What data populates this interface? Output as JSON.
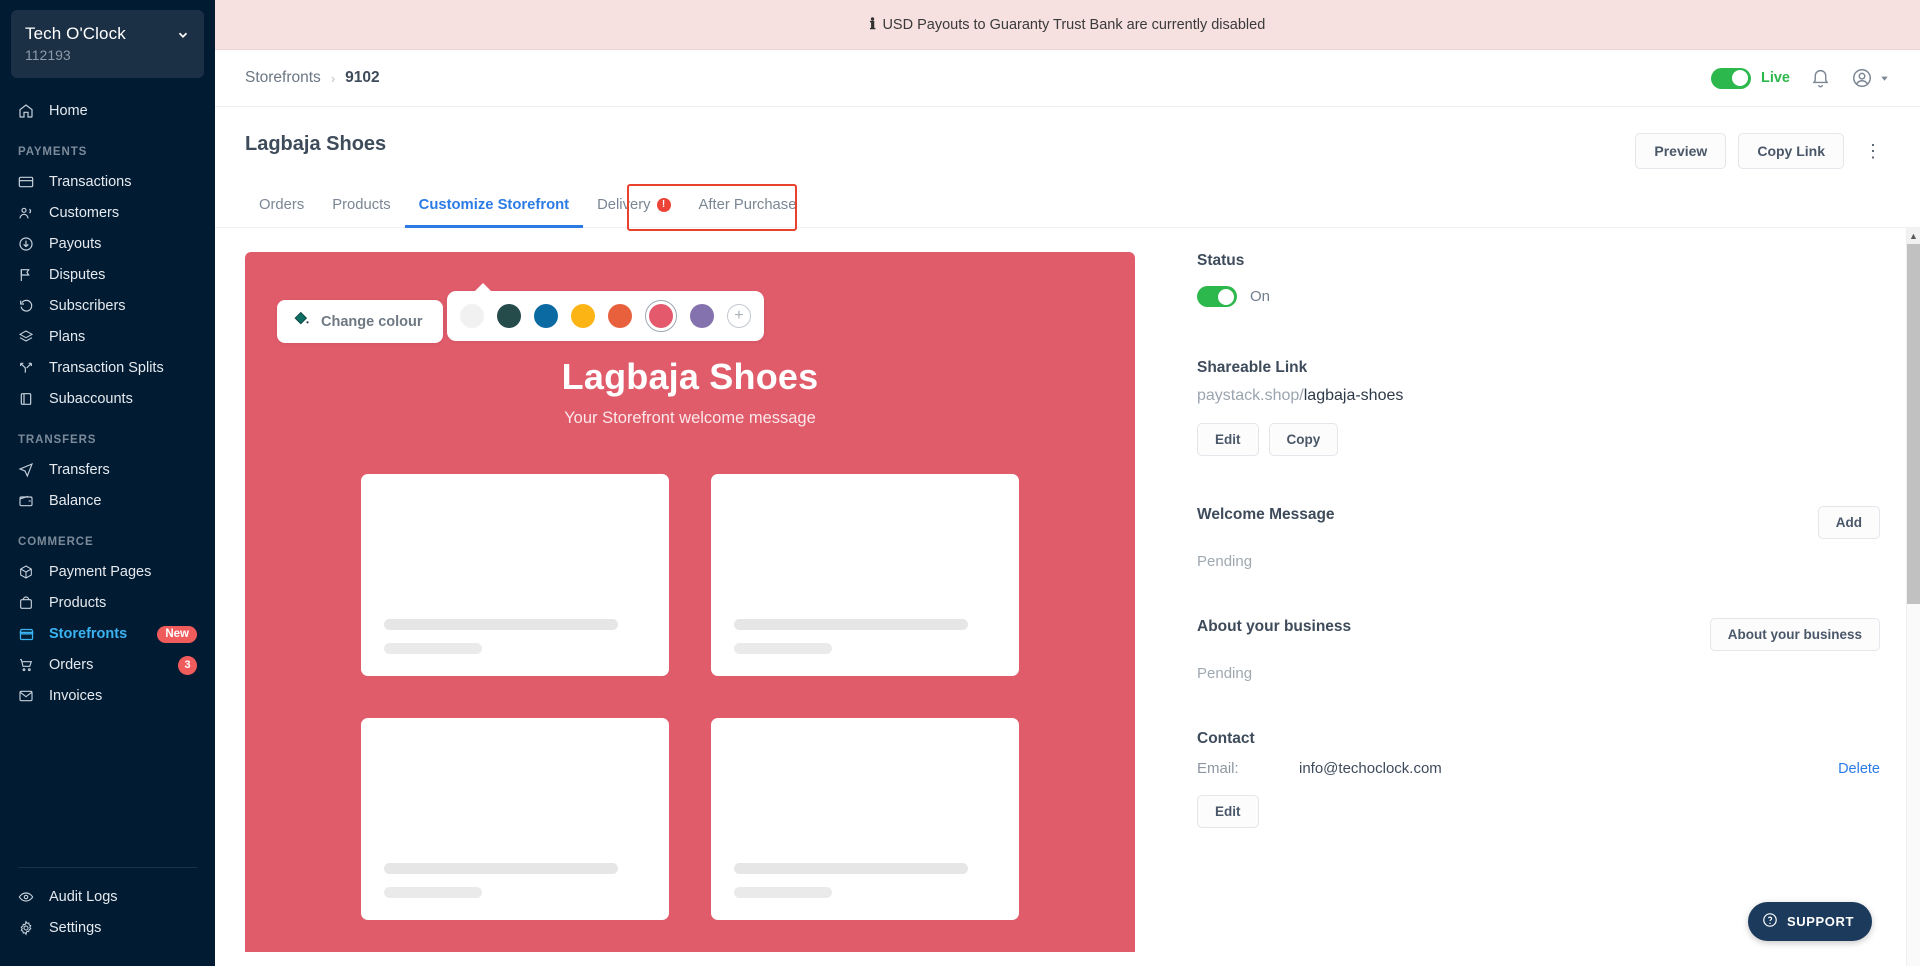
{
  "sidebar": {
    "org": {
      "name": "Tech O'Clock",
      "id": "112193",
      "chevron_icon": "chevron-down-icon"
    },
    "home": {
      "label": "Home",
      "icon": "home-icon"
    },
    "groups": [
      {
        "title": "PAYMENTS",
        "items": [
          {
            "label": "Transactions",
            "icon": "card-icon"
          },
          {
            "label": "Customers",
            "icon": "users-icon"
          },
          {
            "label": "Payouts",
            "icon": "arrow-down-circle-icon"
          },
          {
            "label": "Disputes",
            "icon": "flag-icon"
          },
          {
            "label": "Subscribers",
            "icon": "refresh-icon"
          },
          {
            "label": "Plans",
            "icon": "layers-icon"
          },
          {
            "label": "Transaction Splits",
            "icon": "split-icon"
          },
          {
            "label": "Subaccounts",
            "icon": "book-icon"
          }
        ]
      },
      {
        "title": "TRANSFERS",
        "items": [
          {
            "label": "Transfers",
            "icon": "send-icon"
          },
          {
            "label": "Balance",
            "icon": "wallet-icon"
          }
        ]
      },
      {
        "title": "COMMERCE",
        "items": [
          {
            "label": "Payment Pages",
            "icon": "box-icon"
          },
          {
            "label": "Products",
            "icon": "bag-icon"
          },
          {
            "label": "Storefronts",
            "icon": "store-icon",
            "badge": "New",
            "active": true
          },
          {
            "label": "Orders",
            "icon": "cart-icon",
            "count": "3"
          },
          {
            "label": "Invoices",
            "icon": "mail-icon"
          }
        ]
      }
    ],
    "bottom": [
      {
        "label": "Audit Logs",
        "icon": "eye-icon"
      },
      {
        "label": "Settings",
        "icon": "gear-icon"
      }
    ]
  },
  "notice": {
    "icon": "info-icon",
    "text": "USD Payouts to Guaranty Trust Bank are currently disabled"
  },
  "topbar": {
    "breadcrumb": {
      "parent": "Storefronts",
      "separator": "›",
      "current": "9102"
    },
    "mode_toggle": {
      "label": "Live",
      "state": "on"
    },
    "notifications_icon": "bell-icon",
    "account_icon": "user-circle-icon",
    "account_chevron_icon": "chevron-down-icon"
  },
  "page": {
    "title": "Lagbaja Shoes",
    "actions": {
      "preview": "Preview",
      "copy_link": "Copy Link",
      "more_icon": "kebab-menu-icon"
    },
    "tabs": [
      {
        "label": "Orders",
        "active": false
      },
      {
        "label": "Products",
        "active": false
      },
      {
        "label": "Customize Storefront",
        "active": true,
        "highlighted": true
      },
      {
        "label": "Delivery",
        "active": false,
        "alert": "!"
      },
      {
        "label": "After Purchase",
        "active": false
      }
    ]
  },
  "storefront_preview": {
    "background_color": "#E15C6B",
    "change_colour_button": {
      "label": "Change colour",
      "icon": "paint-bucket-icon"
    },
    "swatches": [
      {
        "color": "#F1F1F1",
        "selected": false
      },
      {
        "color": "#264B4B",
        "selected": false
      },
      {
        "color": "#0B6AA2",
        "selected": false
      },
      {
        "color": "#FCB415",
        "selected": false
      },
      {
        "color": "#E8613C",
        "selected": false
      },
      {
        "color": "#E4596C",
        "selected": true
      },
      {
        "color": "#8472AE",
        "selected": false
      }
    ],
    "add_colour_icon": "plus-circle-icon",
    "heading": "Lagbaja Shoes",
    "subheading": "Your Storefront welcome message",
    "placeholder_cards": 4
  },
  "panel": {
    "status": {
      "title": "Status",
      "toggle_state": "on",
      "value": "On"
    },
    "shareable_link": {
      "title": "Shareable Link",
      "domain": "paystack.shop/",
      "slug": "lagbaja-shoes",
      "edit": "Edit",
      "copy": "Copy"
    },
    "welcome_message": {
      "title": "Welcome Message",
      "value": "Pending",
      "action": "Add"
    },
    "about_business": {
      "title": "About your business",
      "value": "Pending",
      "action": "About your business"
    },
    "contact": {
      "title": "Contact",
      "email_label": "Email:",
      "email_value": "info@techoclock.com",
      "delete": "Delete",
      "edit": "Edit"
    }
  },
  "support": {
    "label": "SUPPORT",
    "icon": "question-circle-icon"
  },
  "scrollbar": {
    "up_arrow_icon": "chevron-up-icon"
  }
}
